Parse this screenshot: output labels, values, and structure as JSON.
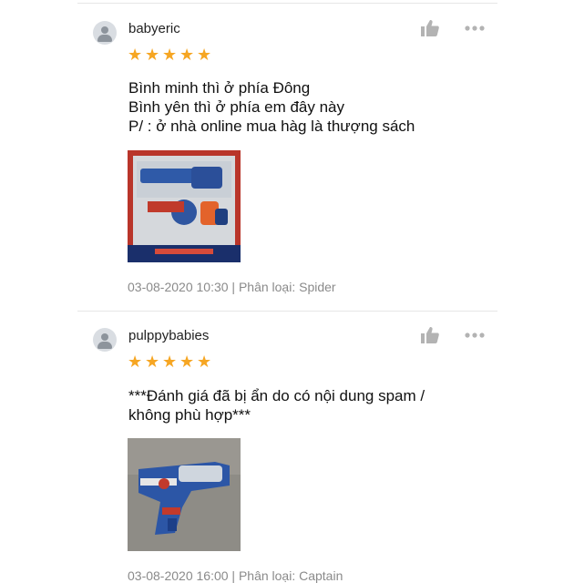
{
  "reviews": [
    {
      "username": "babyeric",
      "rating": 5,
      "text": "Bình minh thì ở phía Đông\nBình yên thì ở phía em đây này\nP/ : ở nhà online mua hàg là thượng sách",
      "meta": "03-08-2020 10:30 | Phân loại: Spider",
      "photo_icon": "toy-blaster-box-photo"
    },
    {
      "username": "pulppybabies",
      "rating": 5,
      "text": "***Đánh giá đã bị ẩn do có nội dung spam /\nkhông phù hợp***",
      "meta": "03-08-2020 16:00 | Phân loại: Captain",
      "photo_icon": "toy-blaster-gun-photo"
    }
  ],
  "icons": {
    "like": "thumbs-up-icon",
    "more": "more-options-icon",
    "avatar": "user-avatar-icon",
    "star": "star-icon"
  },
  "colors": {
    "star": "#f6a623",
    "meta_text": "#8a8a8a",
    "icon_gray": "#b3b3b3"
  }
}
